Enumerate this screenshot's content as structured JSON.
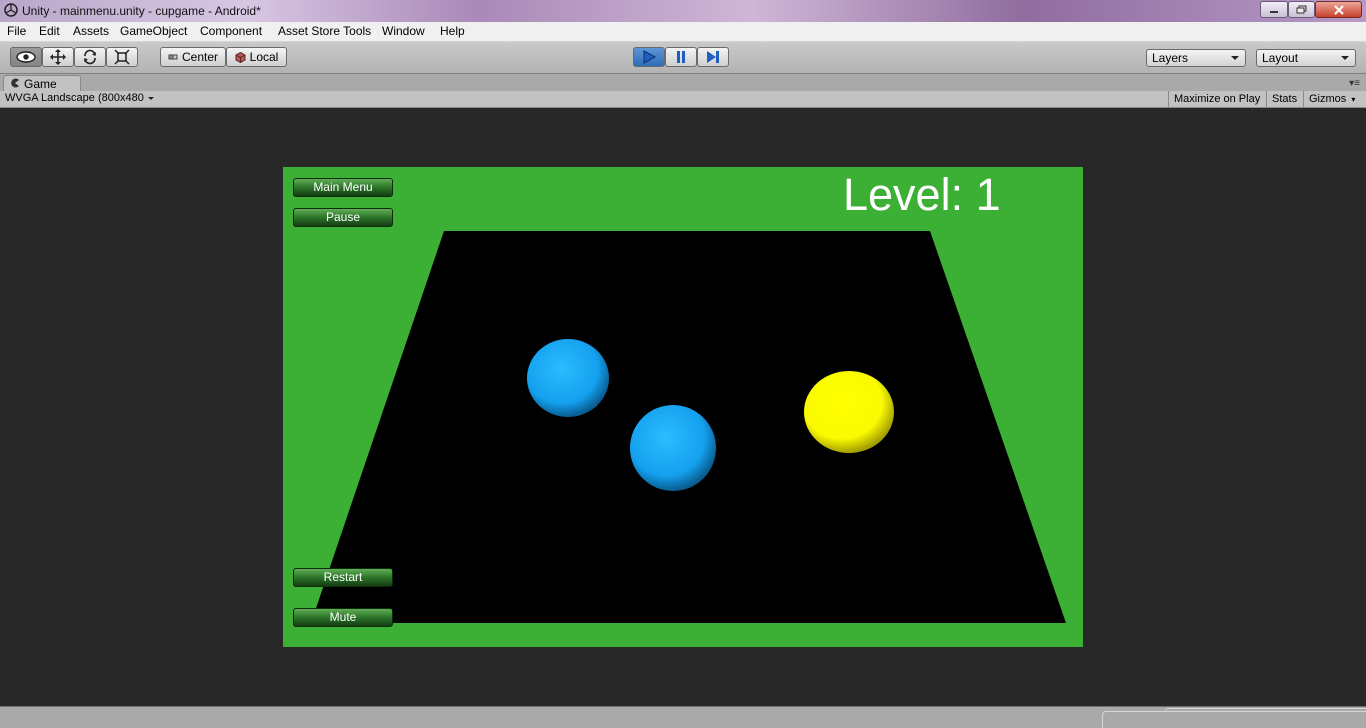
{
  "window": {
    "title": "Unity - mainmenu.unity - cupgame - Android*"
  },
  "menu": [
    "File",
    "Edit",
    "Assets",
    "GameObject",
    "Component",
    "Asset Store Tools",
    "Window",
    "Help"
  ],
  "toolbar": {
    "pivot_center_label": "Center",
    "pivot_local_label": "Local",
    "play_state": "playing",
    "layers_label": "Layers",
    "layout_label": "Layout"
  },
  "game_panel": {
    "tab_label": "Game",
    "aspect_label": "WVGA Landscape (800x480",
    "maximize_label": "Maximize on Play",
    "stats_label": "Stats",
    "gizmos_label": "Gizmos"
  },
  "game": {
    "main_menu_label": "Main Menu",
    "pause_label": "Pause",
    "restart_label": "Restart",
    "mute_label": "Mute",
    "level_text": "Level: 1",
    "colors": {
      "background": "#3cb034",
      "board": "#000000",
      "blue_ball": "#1aa6f2",
      "yellow_ball": "#ffff00"
    }
  }
}
